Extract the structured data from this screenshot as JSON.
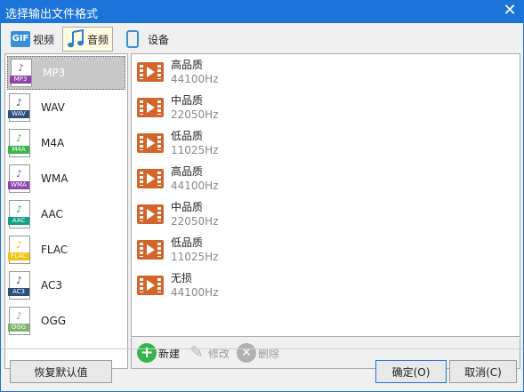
{
  "window": {
    "title": "选择输出文件格式"
  },
  "tabs": [
    {
      "label": "视频",
      "icon": "gif-icon"
    },
    {
      "label": "音频",
      "icon": "music-note-icon"
    },
    {
      "label": "设备",
      "icon": "phone-icon"
    }
  ],
  "formats": [
    {
      "name": "MP3",
      "tag": "MP3",
      "color": "#8e44ad",
      "selected": true
    },
    {
      "name": "WAV",
      "tag": "WAV",
      "color": "#2c4f7c"
    },
    {
      "name": "M4A",
      "tag": "M4A",
      "color": "#3bb54a"
    },
    {
      "name": "WMA",
      "tag": "WMA",
      "color": "#8e44ad"
    },
    {
      "name": "AAC",
      "tag": "AAC",
      "color": "#16a085"
    },
    {
      "name": "FLAC",
      "tag": "FLAC",
      "color": "#f1c40f"
    },
    {
      "name": "AC3",
      "tag": "AC3",
      "color": "#2c4f7c"
    },
    {
      "name": "OGG",
      "tag": "OGG",
      "color": "#7fb36b"
    }
  ],
  "presets": [
    {
      "quality": "高品质",
      "rate": "44100Hz"
    },
    {
      "quality": "中品质",
      "rate": "22050Hz"
    },
    {
      "quality": "低品质",
      "rate": "11025Hz"
    },
    {
      "quality": "高品质",
      "rate": "44100Hz"
    },
    {
      "quality": "中品质",
      "rate": "22050Hz"
    },
    {
      "quality": "低品质",
      "rate": "11025Hz"
    },
    {
      "quality": "无损",
      "rate": "44100Hz"
    }
  ],
  "toolbar": {
    "new_label": "新建",
    "edit_label": "修改",
    "delete_label": "删除"
  },
  "buttons": {
    "reset": "恢复默认值",
    "ok": "确定(O)",
    "cancel": "取消(C)"
  }
}
